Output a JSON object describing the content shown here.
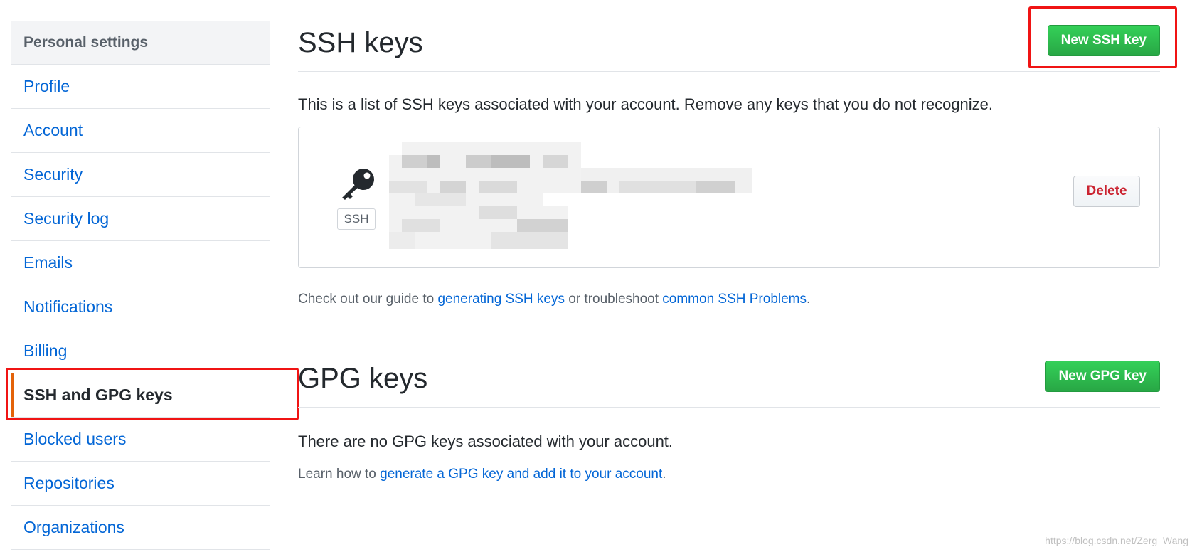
{
  "sidebar": {
    "header": "Personal settings",
    "items": [
      {
        "label": "Profile"
      },
      {
        "label": "Account"
      },
      {
        "label": "Security"
      },
      {
        "label": "Security log"
      },
      {
        "label": "Emails"
      },
      {
        "label": "Notifications"
      },
      {
        "label": "Billing"
      },
      {
        "label": "SSH and GPG keys",
        "selected": true
      },
      {
        "label": "Blocked users"
      },
      {
        "label": "Repositories"
      },
      {
        "label": "Organizations"
      }
    ]
  },
  "ssh": {
    "title": "SSH keys",
    "new_button": "New SSH key",
    "description": "This is a list of SSH keys associated with your account. Remove any keys that you do not recognize.",
    "key": {
      "type_label": "SSH",
      "icon": "key-icon",
      "delete_label": "Delete"
    },
    "guide_prefix": "Check out our guide to ",
    "guide_link": "generating SSH keys",
    "guide_middle": " or troubleshoot ",
    "problems_link": "common SSH Problems",
    "guide_suffix": "."
  },
  "gpg": {
    "title": "GPG keys",
    "new_button": "New GPG key",
    "empty_text": "There are no GPG keys associated with your account.",
    "learn_prefix": "Learn how to ",
    "learn_link": "generate a GPG key and add it to your account",
    "learn_suffix": "."
  },
  "watermark": "https://blog.csdn.net/Zerg_Wang",
  "colors": {
    "link": "#0366d6",
    "green": "#28a745",
    "danger": "#cb2431",
    "highlight": "#f01414",
    "selected_bar": "#e36209"
  }
}
